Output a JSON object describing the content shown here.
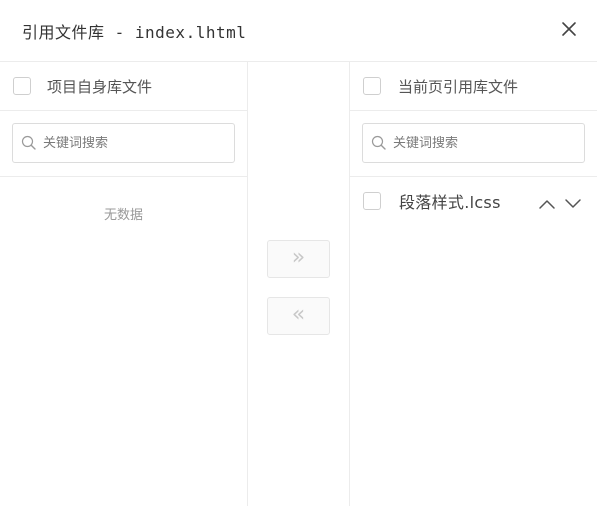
{
  "dialog": {
    "title": "引用文件库 - index.lhtml",
    "close_label": "×"
  },
  "left_panel": {
    "title": "项目自身库文件",
    "search_placeholder": "关键词搜索",
    "empty_text": "无数据",
    "items": []
  },
  "right_panel": {
    "title": "当前页引用库文件",
    "search_placeholder": "关键词搜索",
    "items": [
      {
        "label": "段落样式.lcss"
      }
    ]
  },
  "transfer": {
    "to_right_label": "»",
    "to_left_label": "«"
  },
  "icons": {
    "close": "close-icon",
    "search": "search-icon",
    "up": "chevron-up-icon",
    "down": "chevron-down-icon"
  },
  "colors": {
    "border": "#ececec",
    "text": "#333333",
    "muted": "#999999",
    "disabled": "#c8c8c8"
  }
}
